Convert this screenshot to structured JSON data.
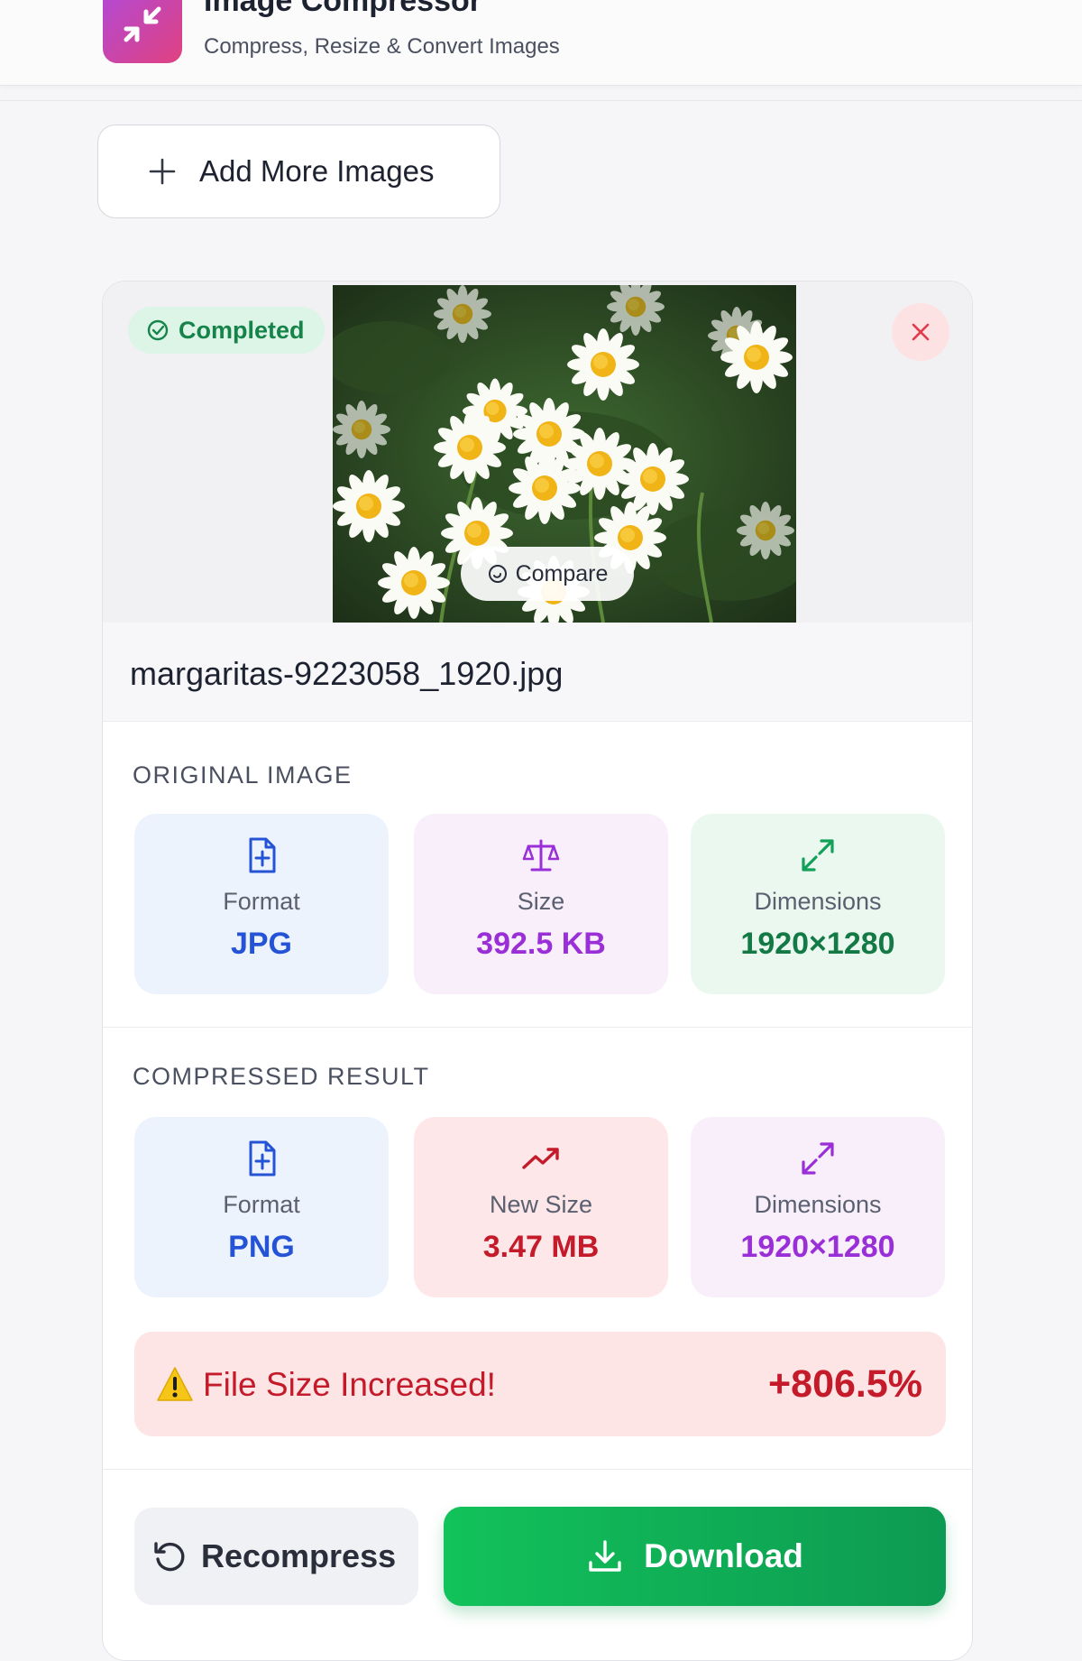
{
  "header": {
    "title": "Image Compressor",
    "subtitle": "Compress, Resize & Convert Images"
  },
  "toolbar": {
    "add_more_label": "Add More Images"
  },
  "card": {
    "status_badge": "Completed",
    "compare_label": "Compare",
    "filename": "margaritas-9223058_1920.jpg",
    "original": {
      "title": "ORIGINAL IMAGE",
      "format_label": "Format",
      "format_value": "JPG",
      "size_label": "Size",
      "size_value": "392.5 KB",
      "dimensions_label": "Dimensions",
      "dimensions_value": "1920×1280"
    },
    "compressed": {
      "title": "COMPRESSED RESULT",
      "format_label": "Format",
      "format_value": "PNG",
      "size_label": "New Size",
      "size_value": "3.47 MB",
      "dimensions_label": "Dimensions",
      "dimensions_value": "1920×1280"
    },
    "warning": {
      "message": "File Size Increased!",
      "percent": "+806.5%"
    },
    "actions": {
      "recompress_label": "Recompress",
      "download_label": "Download"
    }
  },
  "colors": {
    "accent_green": "#12c25a",
    "warning_red": "#c41a2a",
    "blue": "#2553d6",
    "purple": "#9a2fd8",
    "green": "#137a45"
  },
  "icons": {
    "logo": "compress-arrows-icon",
    "add": "plus-icon",
    "badge": "check-circle-icon",
    "close": "close-icon",
    "compare": "compare-icon",
    "format": "file-icon",
    "size": "scale-icon",
    "dimensions": "expand-icon",
    "new_size": "trending-up-icon",
    "warning": "warning-icon",
    "recompress": "refresh-icon",
    "download": "download-icon"
  }
}
